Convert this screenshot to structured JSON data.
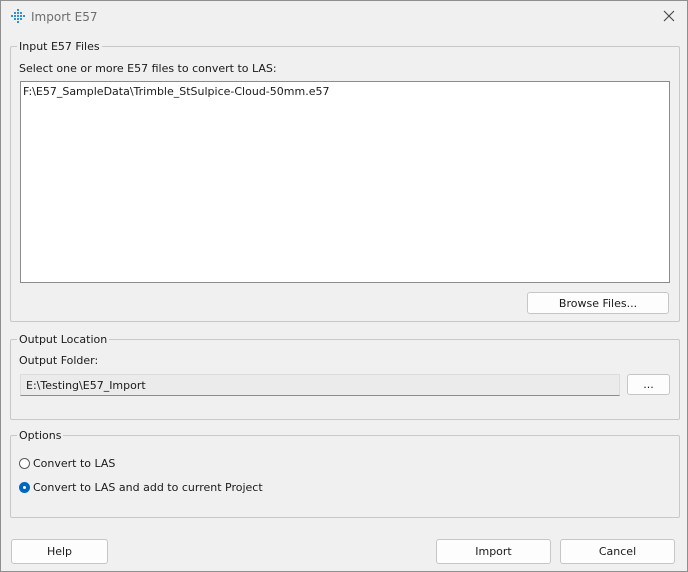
{
  "window": {
    "title": "Import E57"
  },
  "input_group": {
    "legend": "Input E57 Files",
    "instruction": "Select one or more E57 files to convert to LAS:",
    "files": [
      "F:\\E57_SampleData\\Trimble_StSulpice-Cloud-50mm.e57"
    ],
    "browse_label": "Browse Files..."
  },
  "output_group": {
    "legend": "Output Location",
    "folder_label": "Output Folder:",
    "folder_value": "E:\\Testing\\E57_Import",
    "browse_label": "..."
  },
  "options_group": {
    "legend": "Options",
    "radio_convert": "Convert to LAS",
    "radio_convert_add": "Convert to LAS and add to current Project",
    "selected": "convert_add"
  },
  "buttons": {
    "help": "Help",
    "import": "Import",
    "cancel": "Cancel"
  },
  "colors": {
    "accent": "#0067c0",
    "icon": "#2f8fd8"
  },
  "icons": {
    "app": "e57-import-icon",
    "close": "close-icon"
  }
}
